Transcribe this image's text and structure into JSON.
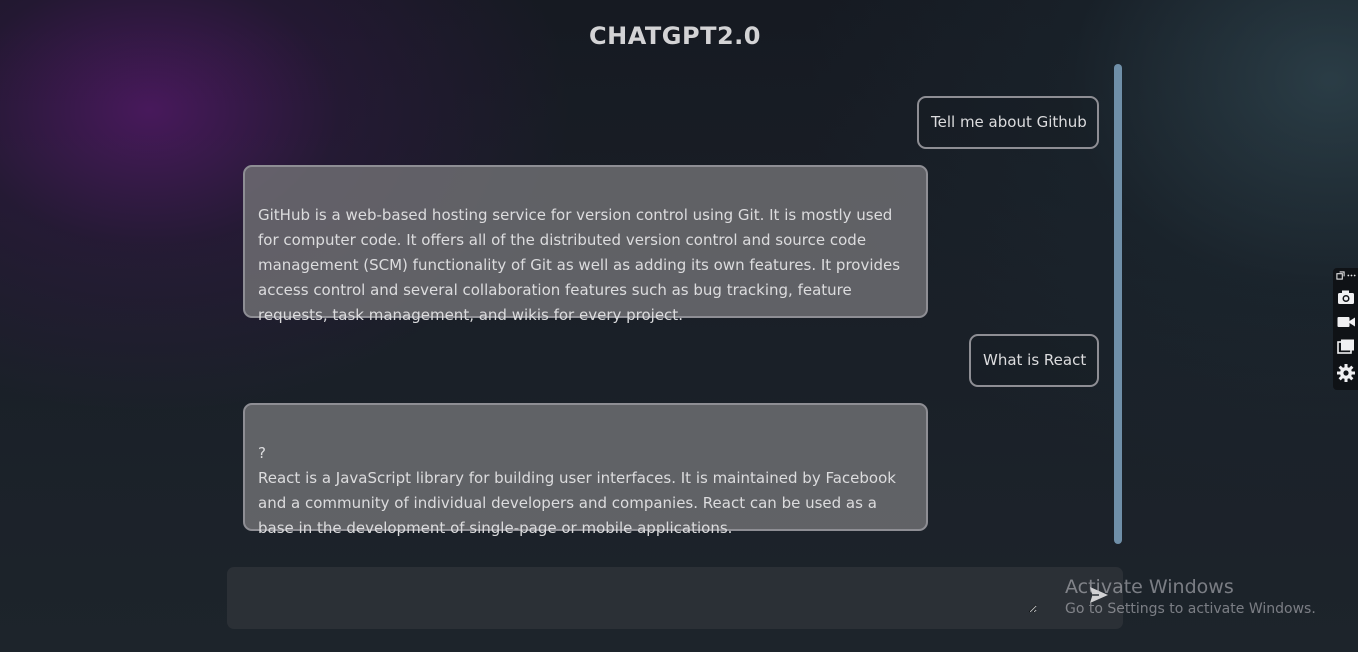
{
  "app": {
    "title": "CHATGPT2.0"
  },
  "messages": [
    {
      "role": "user",
      "text": "Tell me about Github"
    },
    {
      "role": "assistant",
      "text": "GitHub is a web-based hosting service for version control using Git. It is mostly used for computer code. It offers all of the distributed version control and source code management (SCM) functionality of Git as well as adding its own features. It provides access control and several collaboration features such as bug tracking, feature requests, task management, and wikis for every project."
    },
    {
      "role": "user",
      "text": "What is React"
    },
    {
      "role": "assistant",
      "text": "?\nReact is a JavaScript library for building user interfaces. It is maintained by Facebook and a community of individual developers and companies. React can be used as a base in the development of single-page or mobile applications."
    }
  ],
  "composer": {
    "value": "",
    "send_icon": "send-icon"
  },
  "watermark": {
    "title": "Activate Windows",
    "subtitle": "Go to Settings to activate Windows."
  },
  "side_toolbar": {
    "icons": [
      "expand-icon",
      "more-icon",
      "camera-icon",
      "video-icon",
      "windows-icon",
      "gear-icon"
    ]
  },
  "colors": {
    "user_border": "#8e8e94",
    "bot_bubble": "#707074",
    "scrollbar": "#6f8fa8",
    "input_bg": "#2b3036"
  }
}
